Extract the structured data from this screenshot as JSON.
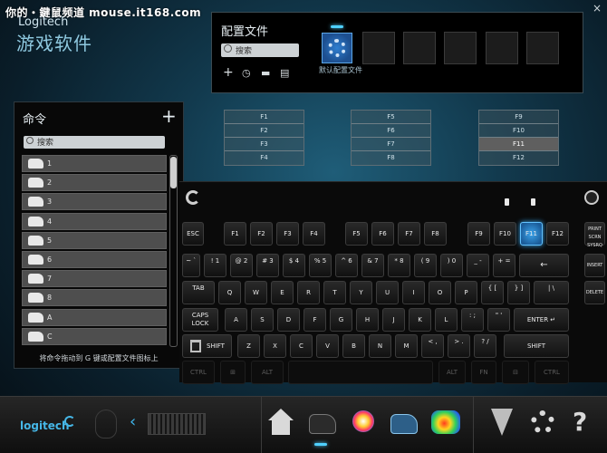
{
  "watermark": "你的・鍵鼠频道 mouse.it168.com",
  "app": {
    "brand_small": "Logitech",
    "title": "游戏软件",
    "close": "×"
  },
  "profiles": {
    "title": "配置文件",
    "search_placeholder": "搜索",
    "tools": [
      "+",
      "◷",
      "▬",
      "▤"
    ],
    "slot_label": "默认配置文件"
  },
  "commands": {
    "title": "命令",
    "add": "+",
    "search_placeholder": "搜索",
    "items": [
      "1",
      "2",
      "3",
      "4",
      "5",
      "6",
      "7",
      "8",
      "A",
      "C"
    ],
    "hint": "将命令拖动到 G 键或配置文件图标上"
  },
  "gkeys": {
    "groups": [
      [
        "F1",
        "F2",
        "F3",
        "F4"
      ],
      [
        "F5",
        "F6",
        "F7",
        "F8"
      ],
      [
        "F9",
        "F10",
        "F11",
        "F12"
      ]
    ],
    "selected": "F11"
  },
  "keyboard": {
    "row_f": [
      "ESC",
      "F1",
      "F2",
      "F3",
      "F4",
      "F5",
      "F6",
      "F7",
      "F8",
      "F9",
      "F10",
      "F11",
      "F12"
    ],
    "row_num": [
      "~ `",
      "! 1",
      "@ 2",
      "# 3",
      "$ 4",
      "% 5",
      "^ 6",
      "& 7",
      "* 8",
      "( 9",
      ") 0",
      "_ -",
      "+ =",
      "←"
    ],
    "row_q": [
      "TAB",
      "Q",
      "W",
      "E",
      "R",
      "T",
      "Y",
      "U",
      "I",
      "O",
      "P",
      "{ [",
      "} ]",
      "| \\"
    ],
    "row_a": [
      "CAPS LOCK",
      "A",
      "S",
      "D",
      "F",
      "G",
      "H",
      "J",
      "K",
      "L",
      ": ;",
      "\" '",
      "ENTER ↵"
    ],
    "row_z": [
      "Z",
      "X",
      "C",
      "V",
      "B",
      "N",
      "M",
      "< ,",
      "> .",
      "? /",
      "SHIFT"
    ],
    "row_ctrl": [
      "CTRL",
      "⊞",
      "ALT",
      "ALT",
      "FN",
      "⊟",
      "CTRL"
    ],
    "side": [
      "PRINT SCRN SYSRQ",
      "INSERT",
      "DELETE"
    ],
    "trash_label": "SHIFT",
    "active_key": "F11"
  },
  "bottom": {
    "logo": "logitech",
    "back": "‹",
    "help": "?"
  }
}
